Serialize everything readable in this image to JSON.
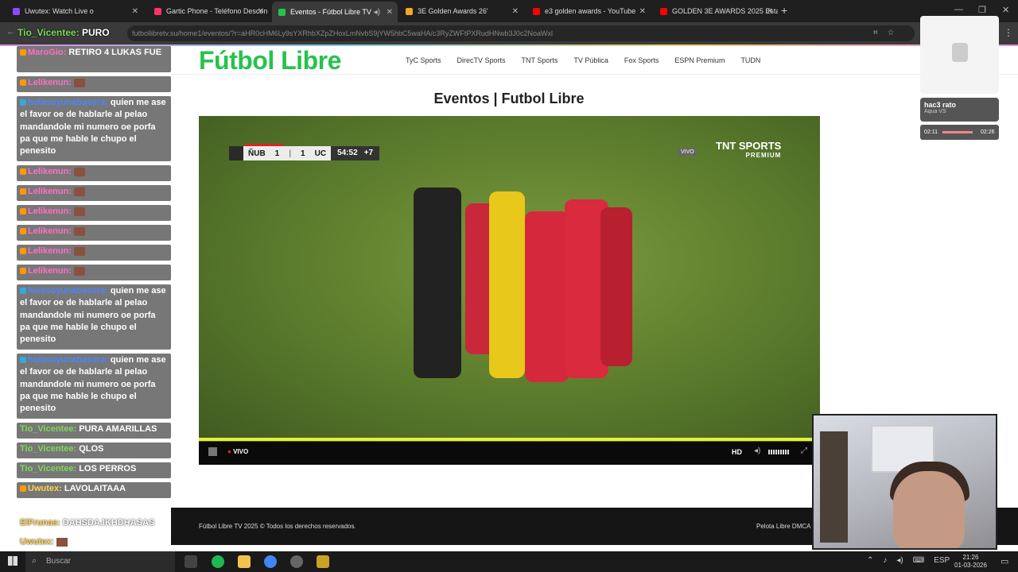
{
  "browser": {
    "tabs": [
      {
        "label": "Uwutex: Watch Live o",
        "color": "#9146ff"
      },
      {
        "label": "Gartic Phone - Teléfono Descon",
        "color": "#f36"
      },
      {
        "label": "Eventos - Fútbol Libre TV",
        "color": "#27c24c",
        "active": true
      },
      {
        "label": "3E Golden Awards 26'",
        "color": "#f5a623"
      },
      {
        "label": "e3 golden awards - YouTube",
        "color": "#f00"
      },
      {
        "label": "GOLDEN 3E AWARDS 2025 Esta",
        "color": "#f00"
      }
    ],
    "address": "futbollibretv.su/home1/eventos/?r=aHR0cHM6Ly9sYXRhbXZpZHoxLmNvbS9jYW5hbC5waHA/c3RyZWFtPXRudHNwb3J0c2NoaWxl"
  },
  "chat": {
    "top_user": "Tio_Vicentee:",
    "top_text": "PURO",
    "messages": [
      {
        "user": "MaroGio:",
        "text": "RETIRO 4 LUKAS FUE",
        "color": "pink"
      },
      {
        "user": "Lelikenun:",
        "text": "",
        "emote": true,
        "color": "pink"
      },
      {
        "user": "holasoyunabasura:",
        "text": "quien me ase el favor oe de hablarle al pelao mandandole mi numero oe porfa pa que me hable le chupo el penesito",
        "color": "blue"
      },
      {
        "user": "Lelikenun:",
        "text": "",
        "emote": true,
        "color": "pink"
      },
      {
        "user": "Lelikenun:",
        "text": "",
        "emote": true,
        "color": "pink"
      },
      {
        "user": "Lelikenun:",
        "text": "",
        "emote": true,
        "color": "pink"
      },
      {
        "user": "Lelikenun:",
        "text": "",
        "emote": true,
        "color": "pink"
      },
      {
        "user": "Lelikenun:",
        "text": "",
        "emote": true,
        "color": "pink"
      },
      {
        "user": "Lelikenun:",
        "text": "",
        "emote": true,
        "color": "pink"
      },
      {
        "user": "holasoyunabasura:",
        "text": "quien me ase el favor oe de hablarle al pelao mandandole mi numero oe porfa pa que me hable le chupo el penesito",
        "color": "blue"
      },
      {
        "user": "holasoyunabasura:",
        "text": "quien me ase el favor oe de hablarle al pelao mandandole mi numero oe porfa pa que me hable le chupo el penesito",
        "color": "blue"
      },
      {
        "user": "Tio_Vicentee:",
        "text": "PURA AMARILLAS",
        "color": "green"
      },
      {
        "user": "Tio_Vicentee:",
        "text": "QLOS",
        "color": "green"
      },
      {
        "user": "Tio_Vicentee:",
        "text": "LOS PERROS",
        "color": "green"
      },
      {
        "user": "Uwutex:",
        "text": "LAVOLAITAAA",
        "color": "pink"
      }
    ],
    "overlay1_user": "ElFrunas:",
    "overlay1_text": "DAHSDAJKHDHASAS",
    "overlay2_user": "Uwutex:"
  },
  "site": {
    "logo": "Fútbol Libre",
    "nav": [
      "TyC Sports",
      "DirecTV Sports",
      "TNT Sports",
      "TV Pública",
      "Fox Sports",
      "ESPN Premium",
      "TUDN"
    ],
    "title": "Eventos | Futbol Libre",
    "footer_copy": "Fútbol Libre TV 2025 © Todos los derechos reservados.",
    "footer_links": "Pelota Libre  DMCA"
  },
  "player": {
    "home": "ÑUB",
    "home_score": "1",
    "away_score": "1",
    "away": "UC",
    "clock": "54:52",
    "added": "+7",
    "live_badge": "VIVO",
    "network": "TNT SPORTS",
    "network_sub": "PREMIUM",
    "live_label": "VIVO",
    "quality": "HD"
  },
  "now_playing": {
    "title": "hac3 rato",
    "artist": "Aqua VS",
    "current": "02:11",
    "total": "02:26",
    "progress": 0.9
  },
  "taskbar": {
    "search": "Buscar",
    "lang": "ESP",
    "time": "21:26",
    "date": "01-03-2026"
  }
}
